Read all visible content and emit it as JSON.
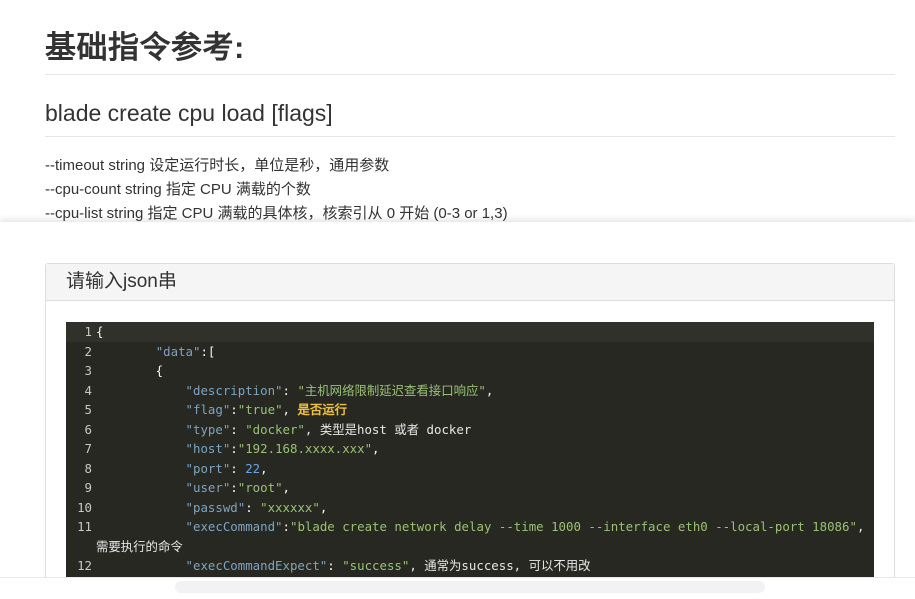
{
  "doc": {
    "heading": "基础指令参考:",
    "command": "blade create cpu load [flags]",
    "flags": [
      "--timeout string 设定运行时长，单位是秒，通用参数",
      "--cpu-count string 指定 CPU 满载的个数",
      "--cpu-list string 指定 CPU 满载的具体核，核索引从 0 开始 (0-3 or 1,3)"
    ]
  },
  "panel": {
    "title": "请输入json串"
  },
  "editor": {
    "lines": [
      {
        "num": "1",
        "t": [
          "{"
        ]
      },
      {
        "num": "2",
        "t": [
          "        ",
          "\"data\"",
          ":["
        ]
      },
      {
        "num": "3",
        "t": [
          "        {"
        ]
      },
      {
        "num": "4",
        "t": [
          "            ",
          "\"description\"",
          ": ",
          "\"主机网络限制延迟查看接口响应\"",
          ","
        ]
      },
      {
        "num": "5",
        "t": [
          "            ",
          "\"flag\"",
          ":",
          "\"true\"",
          ", ",
          "是否运行"
        ]
      },
      {
        "num": "6",
        "t": [
          "            ",
          "\"type\"",
          ": ",
          "\"docker\"",
          ", 类型是host 或者 docker"
        ]
      },
      {
        "num": "7",
        "t": [
          "            ",
          "\"host\"",
          ":",
          "\"192.168.xxxx.xxx\"",
          ","
        ]
      },
      {
        "num": "8",
        "t": [
          "            ",
          "\"port\"",
          ": ",
          "22",
          ","
        ]
      },
      {
        "num": "9",
        "t": [
          "            ",
          "\"user\"",
          ":",
          "\"root\"",
          ","
        ]
      },
      {
        "num": "10",
        "t": [
          "            ",
          "\"passwd\"",
          ": ",
          "\"xxxxxx\"",
          ","
        ]
      },
      {
        "num": "11",
        "t": [
          "            ",
          "\"execCommand\"",
          ":",
          "\"blade create network delay --time 1000 --interface eth0 --local-port 18086\"",
          ", 需要执行的命令"
        ]
      },
      {
        "num": "12",
        "t": [
          "            ",
          "\"execCommandExpect\"",
          ": ",
          "\"success\"",
          ", 通常为success, 可以不用改"
        ]
      }
    ]
  }
}
